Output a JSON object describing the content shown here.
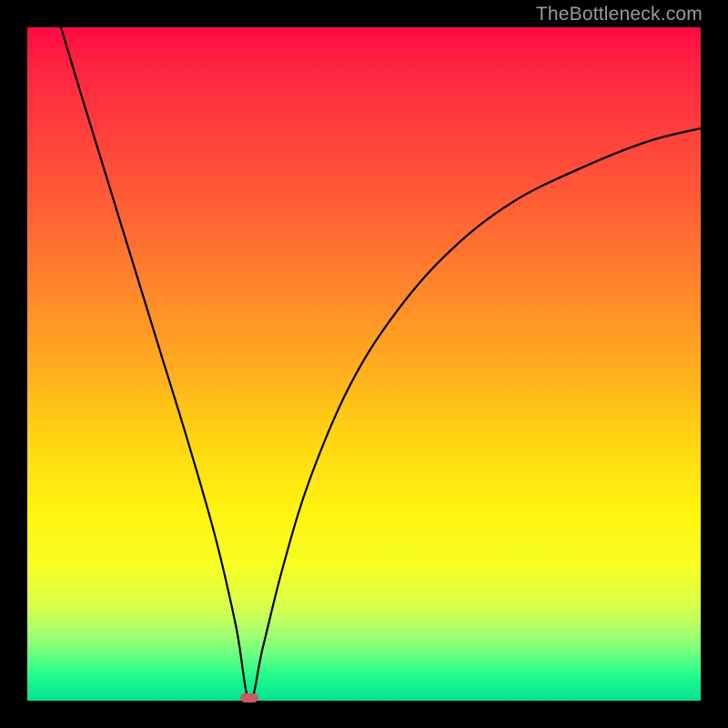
{
  "watermark": "TheBottleneck.com",
  "colors": {
    "curve": "#000000",
    "marker": "#cc5a5f",
    "background_black": "#000000"
  },
  "chart_data": {
    "type": "line",
    "title": "",
    "xlabel": "",
    "ylabel": "",
    "xlim": [
      0,
      100
    ],
    "ylim": [
      0,
      100
    ],
    "grid": false,
    "legend": false,
    "note": "V-shaped bottleneck curve; minimum (optimal match) ≈ x=33, y≈0. Values estimated from pixel positions.",
    "series": [
      {
        "name": "bottleneck_curve",
        "x": [
          5,
          8,
          12,
          16,
          20,
          24,
          28,
          31,
          33,
          35,
          38,
          42,
          48,
          55,
          63,
          72,
          82,
          92,
          100
        ],
        "y": [
          100,
          90,
          77,
          64,
          51,
          38,
          24,
          11,
          0,
          8,
          20,
          33,
          47,
          58,
          67,
          74,
          79,
          83,
          85
        ]
      }
    ],
    "marker": {
      "x": 33,
      "y": 0,
      "shape": "rounded-rect"
    },
    "background_gradient": {
      "orientation": "vertical",
      "stops": [
        {
          "pos": 0.0,
          "color": "#ff0a45"
        },
        {
          "pos": 0.25,
          "color": "#ff5a36"
        },
        {
          "pos": 0.52,
          "color": "#ffb21d"
        },
        {
          "pos": 0.72,
          "color": "#fff410"
        },
        {
          "pos": 0.9,
          "color": "#a6ff6e"
        },
        {
          "pos": 1.0,
          "color": "#07e090"
        }
      ]
    }
  }
}
